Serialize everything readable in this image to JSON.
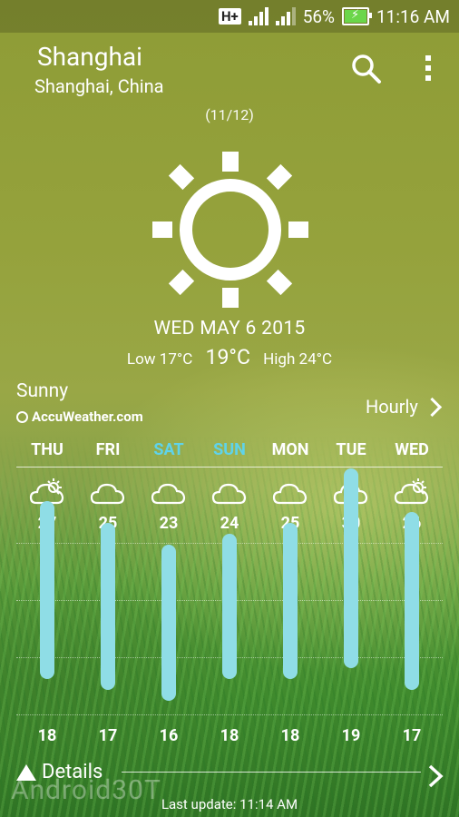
{
  "status_bar": {
    "network": "H+",
    "sim1": "1",
    "sim2": "2",
    "battery": "56%",
    "time": "11:16 AM"
  },
  "location": {
    "city": "Shanghai",
    "region": "Shanghai, China"
  },
  "aqi": "(11/12)",
  "current": {
    "date": "WED MAY 6 2015",
    "low": "Low 17°C",
    "temp": "19°C",
    "high": "High 24°C",
    "condition": "Sunny",
    "icon": "sun-icon"
  },
  "provider": "AccuWeather.com",
  "hourly_label": "Hourly",
  "forecast": [
    {
      "day": "THU",
      "high": "27",
      "low": "18",
      "icon": "partly-cloudy-icon",
      "weekend": false
    },
    {
      "day": "FRI",
      "high": "25",
      "low": "17",
      "icon": "cloud-icon",
      "weekend": false
    },
    {
      "day": "SAT",
      "high": "23",
      "low": "16",
      "icon": "cloud-icon",
      "weekend": true
    },
    {
      "day": "SUN",
      "high": "24",
      "low": "18",
      "icon": "cloud-icon",
      "weekend": true
    },
    {
      "day": "MON",
      "high": "25",
      "low": "18",
      "icon": "cloud-icon",
      "weekend": false
    },
    {
      "day": "TUE",
      "high": "30",
      "low": "19",
      "icon": "cloud-icon",
      "weekend": false
    },
    {
      "day": "WED",
      "high": "26",
      "low": "17",
      "icon": "partly-cloudy-icon",
      "weekend": false
    }
  ],
  "details_label": "Details",
  "watermark": "Android30T",
  "last_update": "Last update: 11:14 AM",
  "colors": {
    "bar": "#8fdde6",
    "weekend": "#5fd3ea",
    "battery": "#6bd64a"
  }
}
